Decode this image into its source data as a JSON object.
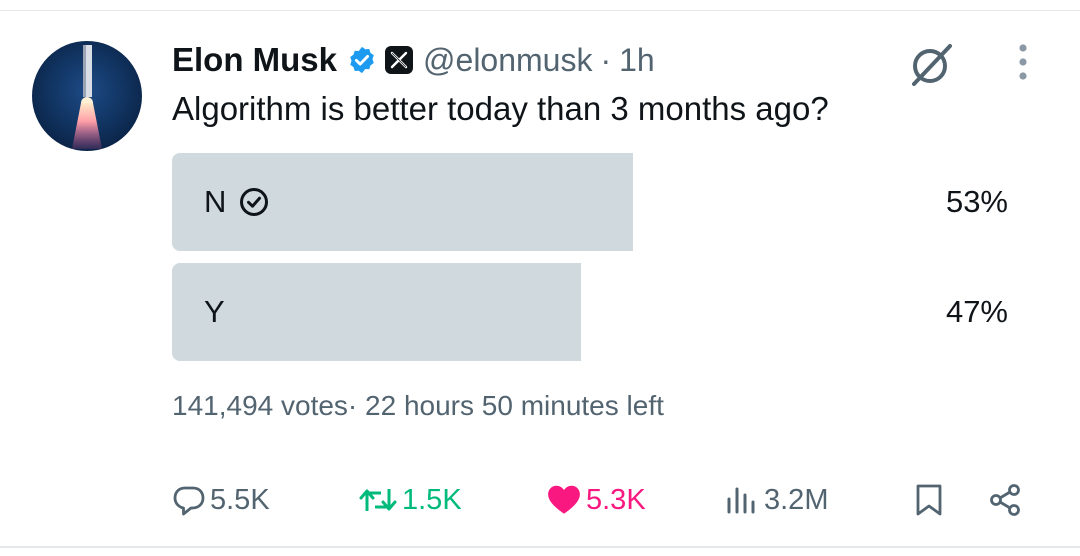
{
  "tweet": {
    "author_name": "Elon Musk",
    "handle": "@elonmusk",
    "separator": "·",
    "time": "1h",
    "text": "Algorithm is better today than 3 months ago?"
  },
  "poll": {
    "options": [
      {
        "label": "N",
        "percent_text": "53%",
        "percent": 53,
        "winner": true
      },
      {
        "label": "Y",
        "percent_text": "47%",
        "percent": 47,
        "winner": false
      }
    ],
    "votes": "141,494 votes",
    "meta_separator": "·",
    "time_left": "22 hours 50 minutes left"
  },
  "actions": {
    "replies": "5.5K",
    "reposts": "1.5K",
    "likes": "5.3K",
    "views": "3.2M"
  },
  "colors": {
    "verified": "#1d9bf0",
    "repost": "#00ba7c",
    "like": "#f91880",
    "muted": "#536471",
    "poll_fill": "#cfd9de"
  },
  "icons": [
    "avatar-image",
    "verified-badge-icon",
    "x-logo-icon",
    "grok-icon",
    "more-icon",
    "check-circle-icon",
    "reply-icon",
    "repost-icon",
    "like-icon",
    "views-icon",
    "bookmark-icon",
    "share-icon"
  ]
}
